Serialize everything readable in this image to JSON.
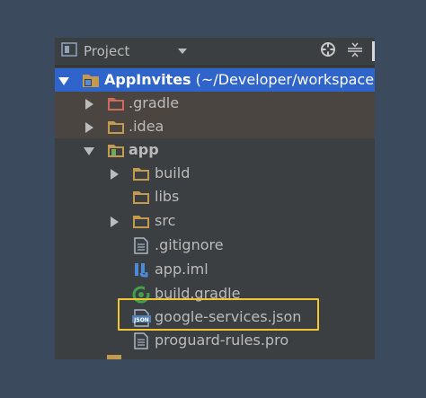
{
  "colors": {
    "background": "#3b4a5c",
    "panel": "#3c3f41",
    "selection": "#2f65ca",
    "text": "#bbbbbb",
    "highlight": "#f2c534",
    "folder": "#c49a4e",
    "excluded_folder": "#d0695a"
  },
  "toolbar": {
    "title": "Project",
    "icons": [
      "project-view-icon",
      "chevron-down-icon",
      "locate-icon",
      "collapse-all-icon"
    ]
  },
  "tree": {
    "root": {
      "name": "AppInvites",
      "path": " (~/Developer/workspace"
    },
    "items": [
      {
        "label": ".gradle",
        "icon": "excluded-folder-icon"
      },
      {
        "label": ".idea",
        "icon": "folder-icon"
      },
      {
        "label": "app",
        "icon": "module-folder-icon"
      },
      {
        "label": "build",
        "icon": "folder-icon"
      },
      {
        "label": "libs",
        "icon": "folder-icon"
      },
      {
        "label": "src",
        "icon": "folder-icon"
      },
      {
        "label": ".gitignore",
        "icon": "text-file-icon"
      },
      {
        "label": "app.iml",
        "icon": "iml-file-icon"
      },
      {
        "label": "build.gradle",
        "icon": "gradle-file-icon"
      },
      {
        "label": "google-services.json",
        "icon": "json-file-icon",
        "badge": "JSON"
      },
      {
        "label": "proguard-rules.pro",
        "icon": "text-file-icon"
      }
    ]
  }
}
